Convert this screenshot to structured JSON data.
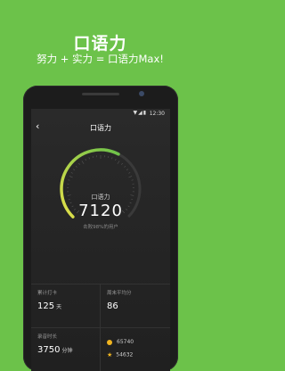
{
  "promo": {
    "title": "口语力",
    "subtitle": "努力 + 实力 = 口语力Max!"
  },
  "status": {
    "icons": "▼◢▮",
    "time": "12:30"
  },
  "nav": {
    "back_icon": "‹",
    "title": "口语力"
  },
  "gauge": {
    "label": "口语力",
    "value": "7120",
    "subtitle": "击败98%的用户",
    "fill_fraction": 0.6,
    "color_start": "#e3e04a",
    "color_end": "#6cc24a"
  },
  "stats": {
    "days": {
      "label": "累计打卡",
      "value": "125",
      "unit": "天"
    },
    "weekly_avg": {
      "label": "周末平均分",
      "value": "86"
    },
    "duration": {
      "label": "录音时长",
      "value": "3750",
      "unit": "分钟"
    },
    "coins": {
      "gold": "65740",
      "star": "54632"
    }
  },
  "colors": {
    "background": "#6cc24a",
    "accent": "#f0b41f"
  }
}
